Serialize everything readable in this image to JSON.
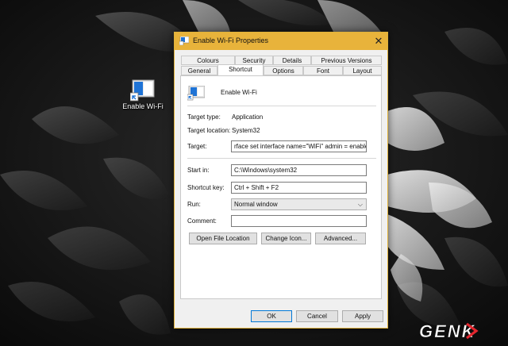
{
  "desktop": {
    "icon_label": "Enable Wi-Fi",
    "icon": "shortcut-icon"
  },
  "dialog": {
    "title": "Enable Wi-Fi Properties",
    "close_glyph": "✕",
    "tabs_top": [
      "Colours",
      "Security",
      "Details",
      "Previous Versions"
    ],
    "tabs_bottom": [
      "General",
      "Shortcut",
      "Options",
      "Font",
      "Layout"
    ],
    "active_tab": "Shortcut",
    "shortcut_name": "Enable Wi-Fi",
    "target_type_label": "Target type:",
    "target_type_value": "Application",
    "target_location_label": "Target location:",
    "target_location_value": "System32",
    "target_label": "Target:",
    "target_value": "rface set interface name=\"WiFi\" admin = enabled",
    "start_in_label": "Start in:",
    "start_in_value": "C:\\Windows\\system32",
    "shortcut_key_label": "Shortcut key:",
    "shortcut_key_value": "Ctrl + Shift + F2",
    "run_label": "Run:",
    "run_value": "Normal window",
    "comment_label": "Comment:",
    "comment_value": "",
    "buttons": {
      "open_file_location": "Open File Location",
      "change_icon": "Change Icon...",
      "advanced": "Advanced...",
      "ok": "OK",
      "cancel": "Cancel",
      "apply": "Apply"
    }
  },
  "watermark": {
    "text": "GENK"
  },
  "colors": {
    "titlebar": "#e8b33b",
    "dialog_bg": "#f0f0f0",
    "accent_blue": "#0078d7",
    "watermark_red": "#e3262e"
  }
}
